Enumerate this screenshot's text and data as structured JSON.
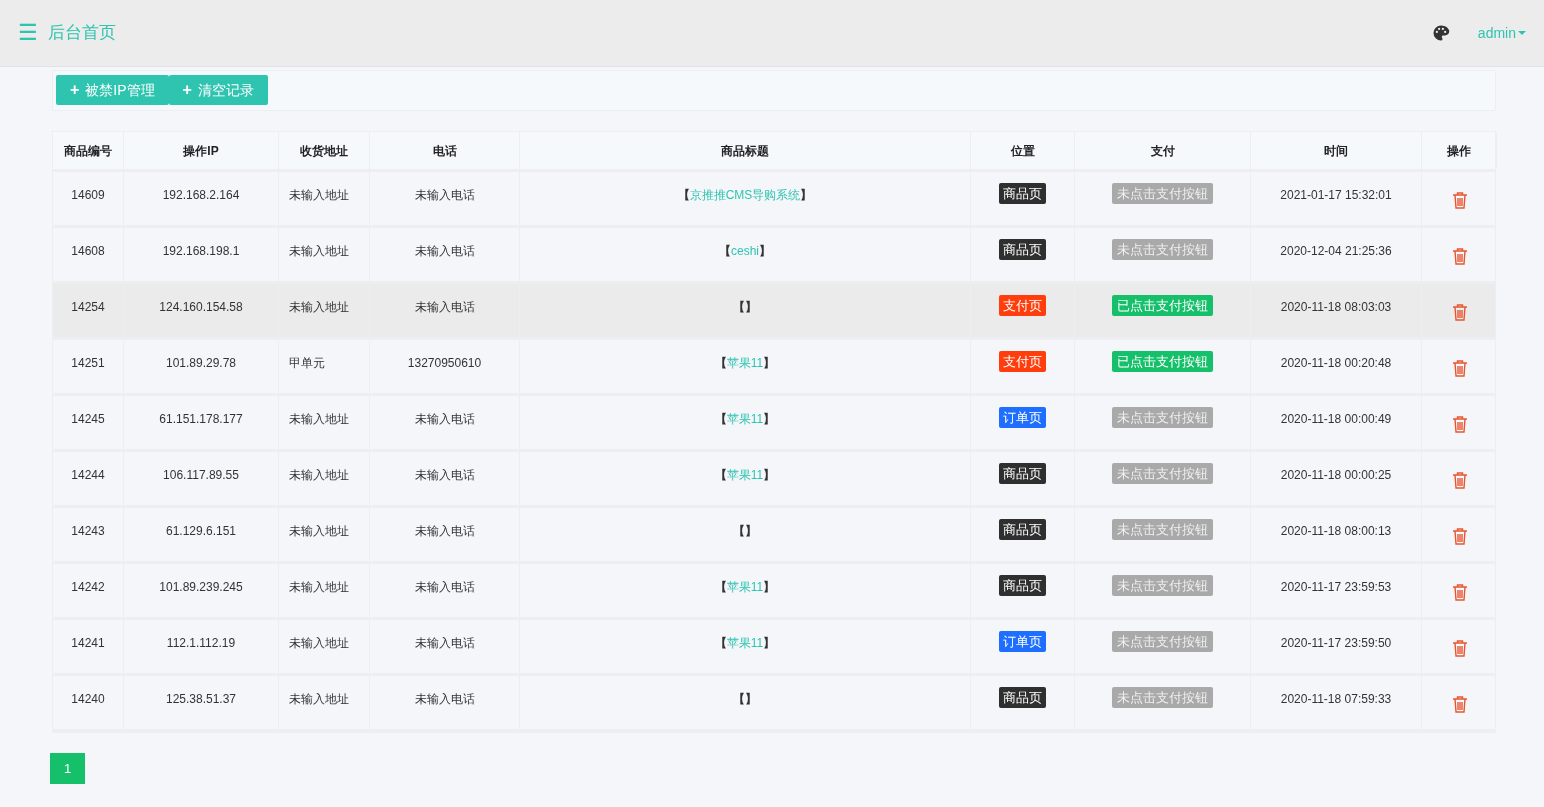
{
  "header": {
    "menu_icon": "☰",
    "title": "后台首页",
    "user": "admin"
  },
  "toolbar": {
    "buttons": [
      {
        "icon": "+",
        "label": "被禁IP管理"
      },
      {
        "icon": "+",
        "label": "清空记录"
      }
    ]
  },
  "table": {
    "columns": [
      "商品编号",
      "操作IP",
      "收货地址",
      "电话",
      "商品标题",
      "位置",
      "支付",
      "时间",
      "操作"
    ],
    "rows": [
      {
        "id": "14609",
        "ip": "192.168.2.164",
        "address": "未输入地址",
        "phone": "未输入电话",
        "title_open": "【",
        "title": "京推推CMS导购系统",
        "title_close": "】",
        "position": {
          "kind": "product",
          "label": "商品页"
        },
        "payment": {
          "clicked": false,
          "label": "未点击支付按钮"
        },
        "time": "2021-01-17 15:32:01",
        "hovered": false
      },
      {
        "id": "14608",
        "ip": "192.168.198.1",
        "address": "未输入地址",
        "phone": "未输入电话",
        "title_open": "【",
        "title": "ceshi",
        "title_close": "】",
        "position": {
          "kind": "product",
          "label": "商品页"
        },
        "payment": {
          "clicked": false,
          "label": "未点击支付按钮"
        },
        "time": "2020-12-04 21:25:36",
        "hovered": false
      },
      {
        "id": "14254",
        "ip": "124.160.154.58",
        "address": "未输入地址",
        "phone": "未输入电话",
        "title_open": "【",
        "title_close": "】",
        "position": {
          "kind": "pay",
          "label": "支付页"
        },
        "payment": {
          "clicked": true,
          "label": "已点击支付按钮"
        },
        "time": "2020-11-18 08:03:03",
        "hovered": true
      },
      {
        "id": "14251",
        "ip": "101.89.29.78",
        "address": "甲单元",
        "phone": "13270950610",
        "title_open": "【",
        "title": "苹果11",
        "title_close": "】",
        "position": {
          "kind": "pay",
          "label": "支付页"
        },
        "payment": {
          "clicked": true,
          "label": "已点击支付按钮"
        },
        "time": "2020-11-18 00:20:48",
        "hovered": false
      },
      {
        "id": "14245",
        "ip": "61.151.178.177",
        "address": "未输入地址",
        "phone": "未输入电话",
        "title_open": "【",
        "title": "苹果11",
        "title_close": "】",
        "position": {
          "kind": "order",
          "label": "订单页"
        },
        "payment": {
          "clicked": false,
          "label": "未点击支付按钮"
        },
        "time": "2020-11-18 00:00:49",
        "hovered": false
      },
      {
        "id": "14244",
        "ip": "106.117.89.55",
        "address": "未输入地址",
        "phone": "未输入电话",
        "title_open": "【",
        "title": "苹果11",
        "title_close": "】",
        "position": {
          "kind": "product",
          "label": "商品页"
        },
        "payment": {
          "clicked": false,
          "label": "未点击支付按钮"
        },
        "time": "2020-11-18 00:00:25",
        "hovered": false
      },
      {
        "id": "14243",
        "ip": "61.129.6.151",
        "address": "未输入地址",
        "phone": "未输入电话",
        "title_open": "【",
        "title_close": "】",
        "position": {
          "kind": "product",
          "label": "商品页"
        },
        "payment": {
          "clicked": false,
          "label": "未点击支付按钮"
        },
        "time": "2020-11-18 08:00:13",
        "hovered": false
      },
      {
        "id": "14242",
        "ip": "101.89.239.245",
        "address": "未输入地址",
        "phone": "未输入电话",
        "title_open": "【",
        "title": "苹果11",
        "title_close": "】",
        "position": {
          "kind": "product",
          "label": "商品页"
        },
        "payment": {
          "clicked": false,
          "label": "未点击支付按钮"
        },
        "time": "2020-11-17 23:59:53",
        "hovered": false
      },
      {
        "id": "14241",
        "ip": "112.1.112.19",
        "address": "未输入地址",
        "phone": "未输入电话",
        "title_open": "【",
        "title": "苹果11",
        "title_close": "】",
        "position": {
          "kind": "order",
          "label": "订单页"
        },
        "payment": {
          "clicked": false,
          "label": "未点击支付按钮"
        },
        "time": "2020-11-17 23:59:50",
        "hovered": false
      },
      {
        "id": "14240",
        "ip": "125.38.51.37",
        "address": "未输入地址",
        "phone": "未输入电话",
        "title_open": "【",
        "title_close": "】",
        "position": {
          "kind": "product",
          "label": "商品页"
        },
        "payment": {
          "clicked": false,
          "label": "未点击支付按钮"
        },
        "time": "2020-11-18 07:59:33",
        "hovered": false
      }
    ]
  },
  "pagination": {
    "pages": [
      {
        "label": "1",
        "selected": true
      }
    ]
  }
}
